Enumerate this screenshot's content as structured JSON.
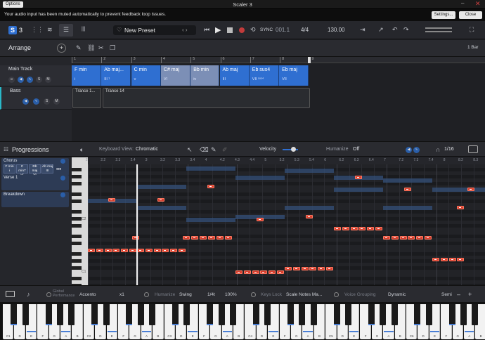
{
  "window": {
    "options_label": "Options",
    "title": "Scaler 3"
  },
  "warning": {
    "message": "Your audio input has been muted automatically to prevent feedback loop issues.",
    "settings_label": "Settings...",
    "close_label": "Close"
  },
  "toolbar": {
    "logo": "S",
    "version": "3",
    "preset_name": "New Preset",
    "sync_label": "SYNC",
    "position": "001.1",
    "time_sig": "4/4",
    "tempo": "130.00"
  },
  "arrange": {
    "title": "Arrange",
    "bar_length": "1 Bar",
    "ruler": [
      "1",
      "2",
      "3",
      "4",
      "5",
      "6",
      "7",
      "8",
      "9"
    ]
  },
  "tracks": [
    {
      "name": "Main Track"
    },
    {
      "name": "Bass"
    }
  ],
  "chords": [
    {
      "name": "F min",
      "roman": "i"
    },
    {
      "name": "Ab maj...",
      "roman": "III ¹"
    },
    {
      "name": "C min",
      "roman": "v"
    },
    {
      "name": "C# maj",
      "roman": "VI"
    },
    {
      "name": "Bb min",
      "roman": "iv"
    },
    {
      "name": "Ab maj",
      "roman": "III"
    },
    {
      "name": "Eb sus4",
      "roman": "VII ˢᵘˢ⁴"
    },
    {
      "name": "Eb maj",
      "roman": "VII"
    }
  ],
  "bass_clips": [
    {
      "name": "Trance 1..."
    },
    {
      "name": "Trance 14"
    }
  ],
  "progressions": {
    "title": "Progressions",
    "keyboard_view_label": "Keyboard View:",
    "keyboard_view_value": "Chromatic",
    "velocity_label": "Velocity",
    "humanize_label": "Humanize",
    "humanize_value": "Off",
    "quantize": "1/16",
    "ruler": [
      "2",
      "2.2",
      "2.3",
      "2.4",
      "3",
      "3.2",
      "3.3",
      "3.4",
      "4",
      "4.2",
      "4.3",
      "4.4",
      "5",
      "5.2",
      "5.3",
      "5.4",
      "6",
      "6.2",
      "6.3",
      "6.4",
      "7",
      "7.2",
      "7.3",
      "7.4",
      "8",
      "8.2",
      "8.3"
    ],
    "sections": [
      {
        "name": "Chorus",
        "chords": [
          {
            "name": "F min",
            "roman": "i"
          },
          {
            "name": "C min7",
            "roman": "v⁷"
          },
          {
            "name": "Db maj",
            "roman": "VI"
          },
          {
            "name": "Ab maj",
            "roman": "III"
          }
        ]
      },
      {
        "name": "Verse 1"
      },
      {
        "name": "Breakdown"
      }
    ],
    "key_labels": [
      "C2",
      "C1"
    ]
  },
  "bottom": {
    "global_label": "Global\nPerformance",
    "accento": "Accento",
    "x1": "x1",
    "humanize": "Humanize",
    "swing": "Swing",
    "rate": "1/4t",
    "pct": "100%",
    "keys_lock": "Keys Lock",
    "scale_notes": "Scale Notes Ma...",
    "voice_grouping": "Voice Grouping",
    "dynamic": "Dynamic",
    "semi": "Semi"
  },
  "keyboard_labels": [
    "C1",
    "D",
    "E",
    "F",
    "G",
    "A",
    "B",
    "C2",
    "D",
    "E",
    "F",
    "G",
    "A",
    "B",
    "C3",
    "D",
    "E",
    "F",
    "G",
    "A",
    "B",
    "C4",
    "D",
    "E",
    "F",
    "G",
    "A",
    "B",
    "C5",
    "D",
    "E",
    "F",
    "G",
    "A",
    "B",
    "C6",
    "D",
    "E",
    "F",
    "G",
    "A",
    "B"
  ],
  "colors": {
    "accent": "#2f6fd1",
    "note": "#d8402f",
    "bass_track": "#2ab8c8"
  },
  "icons": [
    "menu-icon",
    "heart-icon",
    "play-icon",
    "stop-icon",
    "record-icon",
    "loop-icon",
    "undo-icon",
    "redo-icon",
    "expand-icon",
    "pencil-icon",
    "scissors-icon",
    "copy-icon",
    "speaker-icon",
    "eraser-icon"
  ]
}
